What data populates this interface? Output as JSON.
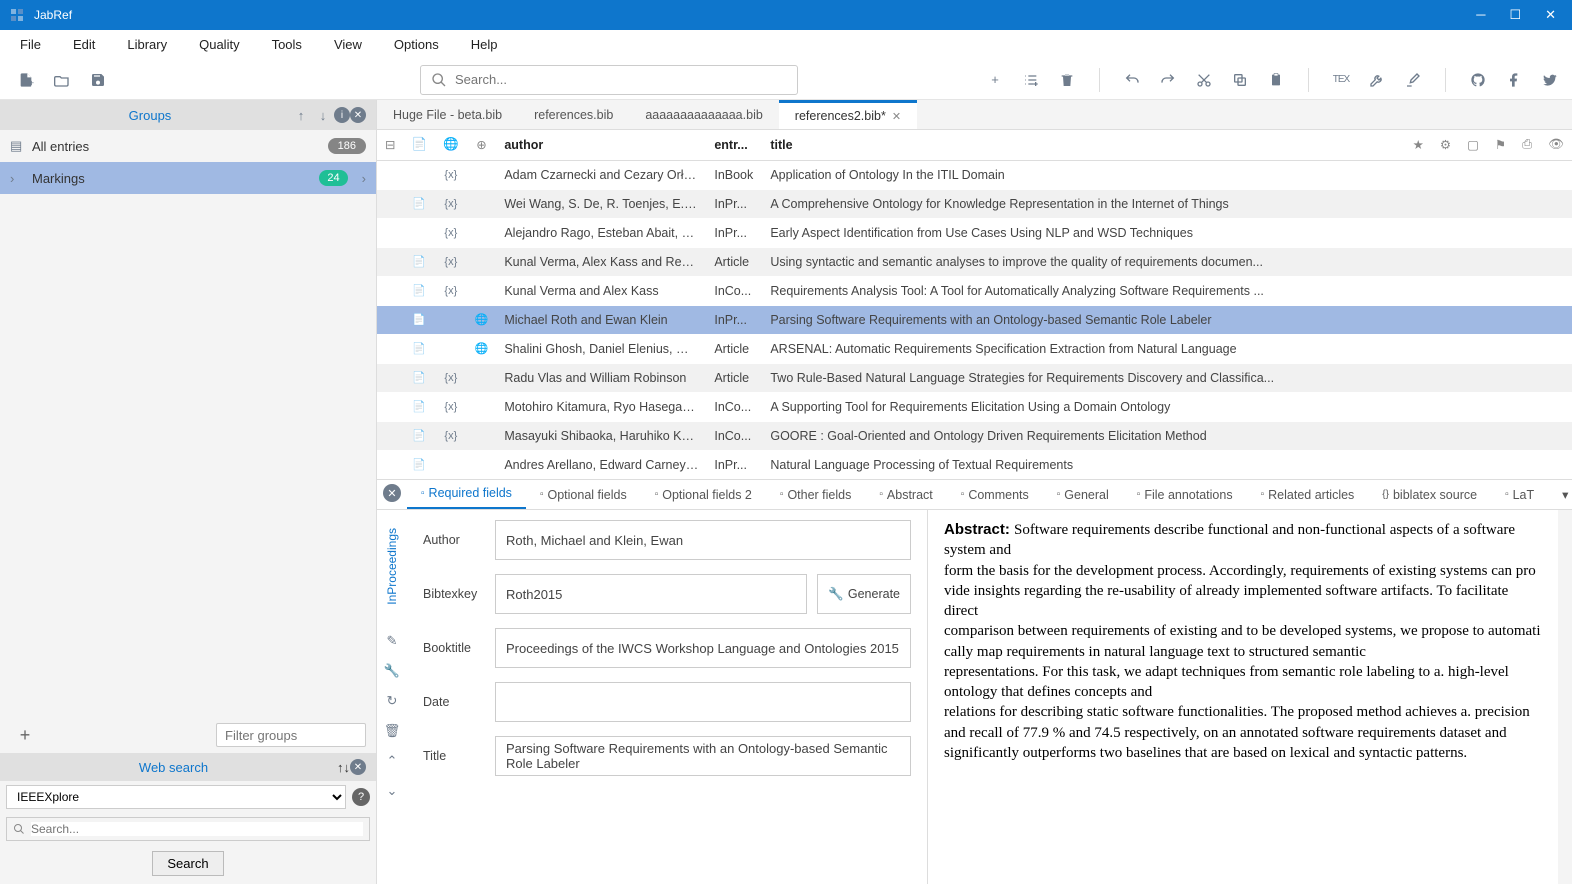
{
  "app": {
    "title": "JabRef"
  },
  "menu": [
    "File",
    "Edit",
    "Library",
    "Quality",
    "Tools",
    "View",
    "Options",
    "Help"
  ],
  "search": {
    "placeholder": "Search..."
  },
  "sidebar": {
    "groups_label": "Groups",
    "all_entries": "All entries",
    "all_count": "186",
    "markings": "Markings",
    "markings_count": "24",
    "filter_placeholder": "Filter groups",
    "websearch_label": "Web search",
    "source": "IEEEXplore",
    "ws_placeholder": "Search...",
    "search_btn": "Search"
  },
  "tabs": [
    {
      "label": "Huge File - beta.bib",
      "active": false
    },
    {
      "label": "references.bib",
      "active": false
    },
    {
      "label": "aaaaaaaaaaaaaa.bib",
      "active": false
    },
    {
      "label": "references2.bib*",
      "active": true
    }
  ],
  "columns": {
    "author": "author",
    "entrytype": "entr...",
    "title": "title"
  },
  "rows": [
    {
      "file": "",
      "id": "{x}",
      "web": "",
      "author": "Adam Czarnecki and Cezary Orłowski",
      "entrytype": "InBook",
      "title": "Application of Ontology In the ITIL Domain"
    },
    {
      "file": "📄",
      "id": "{x}",
      "web": "",
      "author": "Wei Wang, S. De, R. Toenjes, E. Ree...",
      "entrytype": "InPr...",
      "title": "A Comprehensive Ontology for Knowledge Representation in the Internet of Things"
    },
    {
      "file": "",
      "id": "{x}",
      "web": "",
      "author": "Alejandro Rago, Esteban Abait, Cla...",
      "entrytype": "InPr...",
      "title": "Early Aspect Identification from Use Cases Using NLP and WSD Techniques"
    },
    {
      "file": "📄",
      "id": "{x}",
      "web": "",
      "author": "Kunal Verma, Alex Kass and Reymo...",
      "entrytype": "Article",
      "title": "Using syntactic and semantic analyses to improve the quality of requirements documen..."
    },
    {
      "file": "📄",
      "id": "{x}",
      "web": "",
      "author": "Kunal Verma and Alex Kass",
      "entrytype": "InCo...",
      "title": "Requirements Analysis Tool: A Tool for Automatically Analyzing Software Requirements ..."
    },
    {
      "file": "📄",
      "id": "",
      "web": "🌐",
      "author": "Michael Roth and Ewan Klein",
      "entrytype": "InPr...",
      "title": "Parsing Software Requirements with an Ontology-based Semantic Role Labeler",
      "selected": true
    },
    {
      "file": "📄",
      "id": "",
      "web": "🌐",
      "author": "Shalini Ghosh, Daniel Elenius, Wenc...",
      "entrytype": "Article",
      "title": "ARSENAL: Automatic Requirements Specification Extraction from Natural Language"
    },
    {
      "file": "📄",
      "id": "{x}",
      "web": "",
      "author": "Radu Vlas and William Robinson",
      "entrytype": "Article",
      "title": "Two Rule-Based Natural Language Strategies for Requirements Discovery and Classifica..."
    },
    {
      "file": "📄",
      "id": "{x}",
      "web": "",
      "author": "Motohiro Kitamura, Ryo Hasegawa,...",
      "entrytype": "InCo...",
      "title": "A Supporting Tool for Requirements Elicitation Using a Domain Ontology"
    },
    {
      "file": "📄",
      "id": "{x}",
      "web": "",
      "author": "Masayuki Shibaoka, Haruhiko Kaiya...",
      "entrytype": "InCo...",
      "title": "GOORE : Goal-Oriented and Ontology Driven Requirements Elicitation Method"
    },
    {
      "file": "📄",
      "id": "",
      "web": "",
      "author": "Andres Arellano, Edward Carney an...",
      "entrytype": "InPr...",
      "title": "Natural Language Processing of Textual Requirements"
    }
  ],
  "entry_tabs": [
    "Required fields",
    "Optional fields",
    "Optional fields 2",
    "Other fields",
    "Abstract",
    "Comments",
    "General",
    "File annotations",
    "Related articles",
    "biblatex source",
    "LaT"
  ],
  "entry": {
    "type_label": "InProceedings",
    "author_label": "Author",
    "author": "Roth, Michael and Klein, Ewan",
    "bibtexkey_label": "Bibtexkey",
    "bibtexkey": "Roth2015",
    "generate": "Generate",
    "booktitle_label": "Booktitle",
    "booktitle": "Proceedings of the IWCS Workshop Language and Ontologies 2015",
    "date_label": "Date",
    "date": "",
    "title_label": "Title",
    "title": "Parsing Software Requirements with an Ontology-based Semantic Role Labeler"
  },
  "abstract": {
    "label": "Abstract:",
    "lines": [
      "Software requirements describe functional and non-functional aspects of a software system and",
      "form the basis for the development process. Accordingly, requirements of existing systems can pro",
      "vide insights regarding the re-usability of already implemented software artifacts. To facilitate direct",
      "comparison between requirements of existing and to be developed systems, we propose to automati",
      "cally map requirements in natural language text to structured semantic",
      "representations. For this task, we adapt techniques from semantic role labeling to a. high-level ontology that defines concepts and",
      "relations for describing static software functionalities. The proposed method achieves a. precision and recall of 77.9 % and 74.5 respectively, on an annotated software requirements dataset and",
      "significantly outperforms two baselines that are based on lexical and syntactic patterns."
    ]
  }
}
